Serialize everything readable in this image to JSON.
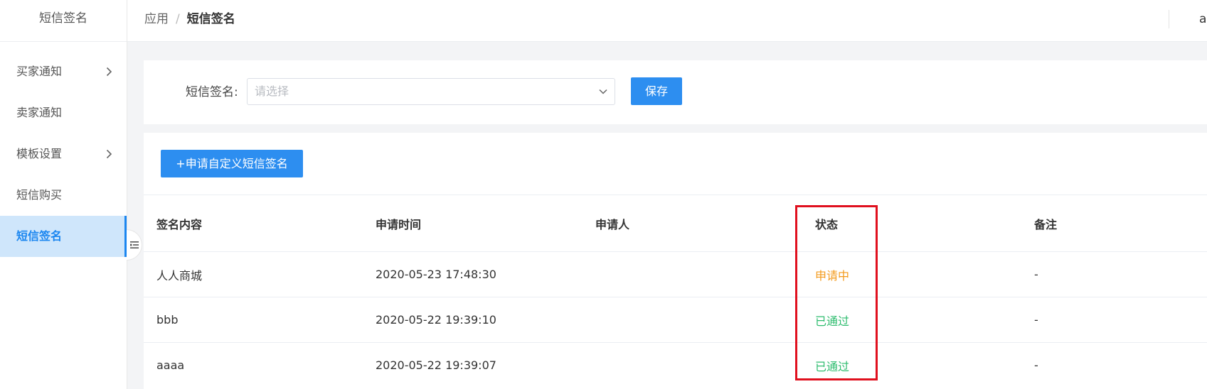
{
  "sidebar": {
    "title": "短信签名",
    "items": [
      {
        "label": "买家通知",
        "has_children": true
      },
      {
        "label": "卖家通知",
        "has_children": false
      },
      {
        "label": "模板设置",
        "has_children": true
      },
      {
        "label": "短信购买",
        "has_children": false
      },
      {
        "label": "短信签名",
        "has_children": false,
        "active": true
      }
    ]
  },
  "header": {
    "breadcrumb": [
      "应用",
      "/",
      "短信签名"
    ],
    "user": "ad"
  },
  "form": {
    "label": "短信签名:",
    "select_placeholder": "请选择",
    "save_label": "保存"
  },
  "list": {
    "apply_label": "+申请自定义短信签名",
    "columns": [
      "签名内容",
      "申请时间",
      "申请人",
      "状态",
      "备注"
    ],
    "rows": [
      {
        "content": "人人商城",
        "time": "2020-05-23 17:48:30",
        "applicant": "",
        "status": "申请中",
        "remark": "-"
      },
      {
        "content": "bbb",
        "time": "2020-05-22 19:39:10",
        "applicant": "",
        "status": "已通过",
        "remark": "-"
      },
      {
        "content": "aaaa",
        "time": "2020-05-22 19:39:07",
        "applicant": "",
        "status": "已通过",
        "remark": "-"
      }
    ]
  },
  "colors": {
    "primary": "#2d8ef0",
    "pending": "#f39a1b",
    "approved": "#2dbc6e",
    "highlight": "#e0101e"
  }
}
